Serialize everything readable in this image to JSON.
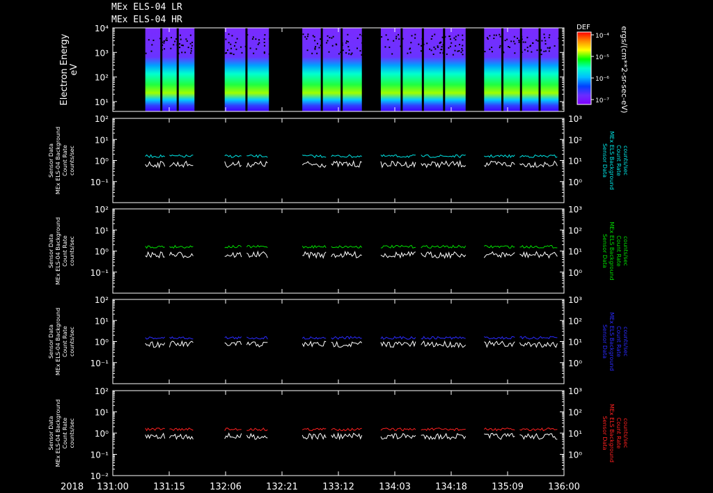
{
  "titles": [
    "MEx ELS-04 LR",
    "MEx ELS-04 HR"
  ],
  "time_axis": {
    "year_label": "2018",
    "tick_labels": [
      "131:00",
      "131:15",
      "132:06",
      "132:21",
      "133:12",
      "134:03",
      "134:18",
      "135:09",
      "136:00"
    ]
  },
  "colorbar": {
    "label": "DEF",
    "unit": "ergs/(cm**2-sr-sec-eV)",
    "tick_labels": [
      "10⁻⁴",
      "10⁻⁵",
      "10⁻⁶",
      "10⁻⁷"
    ],
    "colors": [
      "#ff0000",
      "#ff8c00",
      "#ffff00",
      "#00ff00",
      "#00ffcc",
      "#00bfff",
      "#0040ff",
      "#6a2cff",
      "#7f00ff"
    ]
  },
  "colors": {
    "background": "#000000",
    "axes": "#ffffff",
    "trace_primary": "#ffffff",
    "panel_colors": [
      "#00e5e5",
      "#00dd00",
      "#2a2aff",
      "#ff2020"
    ]
  },
  "chart_data": [
    {
      "type": "heatmap",
      "title": "MEx ELS-04 LR / MEx ELS-04 HR",
      "ylabel": [
        "Electron Energy",
        "eV"
      ],
      "yscale": "log",
      "ylim": [
        1,
        10000
      ],
      "y_tick_labels": [
        "10⁴",
        "10³",
        "10²",
        "10¹"
      ],
      "x_tick_labels": [
        "131:00",
        "131:15",
        "132:06",
        "132:21",
        "133:12",
        "134:03",
        "134:18",
        "135:09",
        "136:00"
      ],
      "data_intervals_fraction": [
        [
          0.072,
          0.181
        ],
        [
          0.248,
          0.346
        ],
        [
          0.42,
          0.552
        ],
        [
          0.594,
          0.782
        ],
        [
          0.823,
          0.988
        ]
      ],
      "colorbar_label": "DEF",
      "colorbar_unit": "ergs/(cm**2-sr-sec-eV)"
    },
    {
      "type": "line",
      "ylabel": [
        "Sensor Data",
        "MEx ELS-04 Background",
        "Count Rate",
        "counts/sec"
      ],
      "ylabel_right": [
        "Sensor Data",
        "MEx ELS Background",
        "Count Rate",
        "counts/sec"
      ],
      "yscale": "log",
      "ylim": [
        0.01,
        100
      ],
      "y_tick_labels": [
        "10²",
        "10¹",
        "10⁰",
        "10⁻¹"
      ],
      "y2_tick_labels": [
        "10³",
        "10²",
        "10¹",
        "10⁰"
      ],
      "series": [
        {
          "color": "#ffffff",
          "level": 0.8
        },
        {
          "color": "#00e5e5",
          "level": 1.6
        }
      ]
    },
    {
      "type": "line",
      "ylabel": [
        "Sensor Data",
        "MEx ELS-04 Background",
        "Count Rate",
        "counts/sec"
      ],
      "ylabel_right": [
        "Sensor Data",
        "MEx ELS Background",
        "Count Rate",
        "counts/sec"
      ],
      "yscale": "log",
      "ylim": [
        0.01,
        100
      ],
      "y_tick_labels": [
        "10²",
        "10¹",
        "10⁰",
        "10⁻¹"
      ],
      "y2_tick_labels": [
        "10³",
        "10²",
        "10¹",
        "10⁰"
      ],
      "series": [
        {
          "color": "#ffffff",
          "level": 0.8
        },
        {
          "color": "#00dd00",
          "level": 1.6
        }
      ]
    },
    {
      "type": "line",
      "ylabel": [
        "Sensor Data",
        "MEx ELS-04 Background",
        "Count Rate",
        "counts/sec"
      ],
      "ylabel_right": [
        "Sensor Data",
        "MEx ELS Background",
        "Count Rate",
        "counts/sec"
      ],
      "yscale": "log",
      "ylim": [
        0.01,
        100
      ],
      "y_tick_labels": [
        "10²",
        "10¹",
        "10⁰",
        "10⁻¹"
      ],
      "y2_tick_labels": [
        "10³",
        "10²",
        "10¹",
        "10⁰"
      ],
      "series": [
        {
          "color": "#ffffff",
          "level": 0.9
        },
        {
          "color": "#2a2aff",
          "level": 1.5
        }
      ]
    },
    {
      "type": "line",
      "ylabel": [
        "Sensor Data",
        "MEx ELS-04 Background",
        "Count Rate",
        "counts/sec"
      ],
      "ylabel_right": [
        "Sensor Data",
        "MEx ELS Background",
        "Count Rate",
        "counts/sec"
      ],
      "yscale": "log",
      "ylim": [
        0.01,
        100
      ],
      "y_tick_labels": [
        "10²",
        "10¹",
        "10⁰",
        "10⁻¹",
        "10⁻²"
      ],
      "y2_tick_labels": [
        "10³",
        "10²",
        "10¹",
        "10⁰"
      ],
      "series": [
        {
          "color": "#ffffff",
          "level": 0.85
        },
        {
          "color": "#ff2020",
          "level": 1.5
        }
      ]
    }
  ]
}
